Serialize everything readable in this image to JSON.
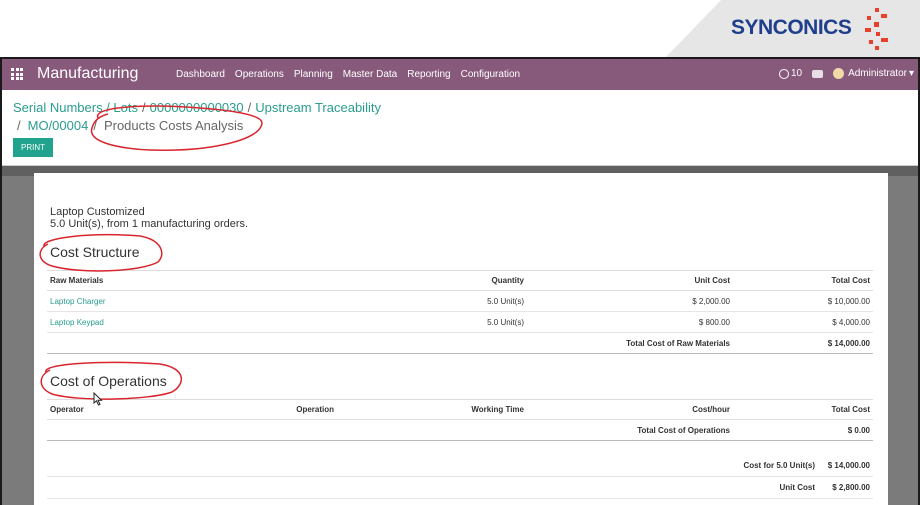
{
  "brand": {
    "name": "SYNCONICS"
  },
  "navbar": {
    "app_title": "Manufacturing",
    "menu": [
      "Dashboard",
      "Operations",
      "Planning",
      "Master Data",
      "Reporting",
      "Configuration"
    ],
    "activity_count": "10",
    "user": "Administrator"
  },
  "breadcrumb": {
    "items": [
      "Serial Numbers / Lots",
      "0000000000030",
      "Upstream Traceability",
      "MO/00004"
    ],
    "current": "Products Costs Analysis"
  },
  "toolbar": {
    "print_label": "PRINT"
  },
  "report": {
    "product_name": "Laptop Customized",
    "product_sub": "5.0 Unit(s), from 1 manufacturing orders.",
    "cost_structure_title": "Cost Structure",
    "raw_headers": [
      "Raw Materials",
      "Quantity",
      "Unit Cost",
      "Total Cost"
    ],
    "raw_rows": [
      {
        "name": "Laptop Charger",
        "qty": "5.0 Unit(s)",
        "unit_cost": "$ 2,000.00",
        "total": "$ 10,000.00"
      },
      {
        "name": "Laptop Keypad",
        "qty": "5.0 Unit(s)",
        "unit_cost": "$ 800.00",
        "total": "$ 4,000.00"
      }
    ],
    "raw_total_label": "Total Cost of Raw Materials",
    "raw_total_value": "$ 14,000.00",
    "operations_title": "Cost of Operations",
    "op_headers": [
      "Operator",
      "Operation",
      "Working Time",
      "Cost/hour",
      "Total Cost"
    ],
    "op_total_label": "Total Cost of Operations",
    "op_total_value": "$ 0.00",
    "cost_for_label": "Cost for 5.0 Unit(s)",
    "cost_for_value": "$ 14,000.00",
    "unit_cost_label": "Unit Cost",
    "unit_cost_value": "$ 2,800.00"
  }
}
